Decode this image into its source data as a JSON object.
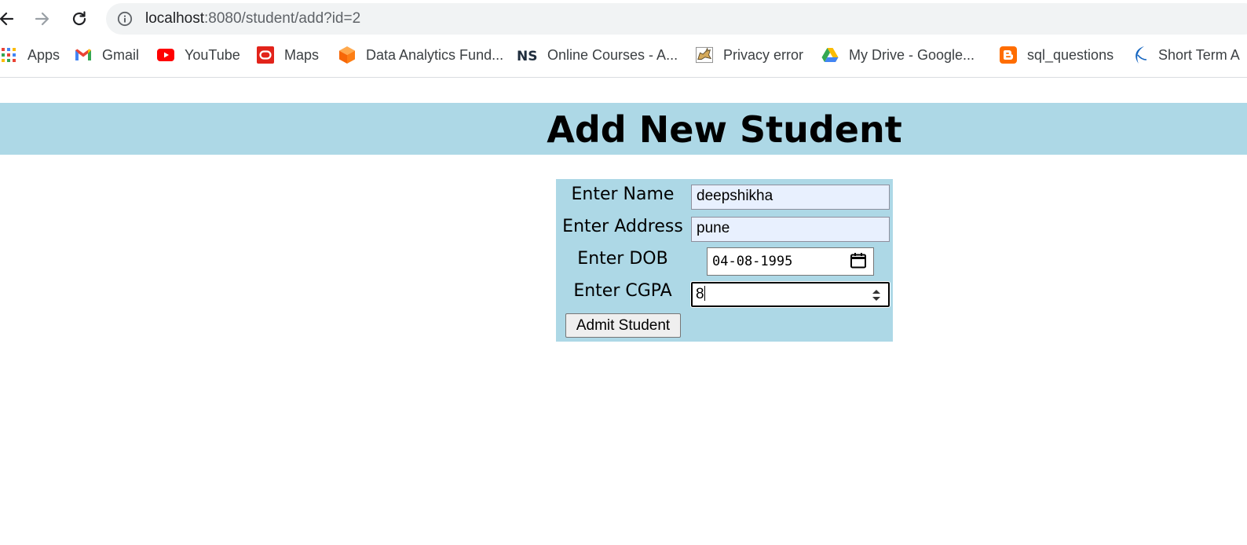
{
  "browser": {
    "url_host": "localhost",
    "url_rest": ":8080/student/add?id=2"
  },
  "bookmarks": [
    {
      "label": "Apps",
      "icon": "apps-grid-icon"
    },
    {
      "label": "Gmail",
      "icon": "gmail-icon"
    },
    {
      "label": "YouTube",
      "icon": "youtube-icon"
    },
    {
      "label": "Maps",
      "icon": "oracle-icon"
    },
    {
      "label": "Data Analytics Fund...",
      "icon": "cube-icon"
    },
    {
      "label": "Online Courses - A...",
      "icon": "ns-logo-icon"
    },
    {
      "label": "Privacy error",
      "icon": "tomcat-icon"
    },
    {
      "label": "My Drive - Google...",
      "icon": "google-drive-icon"
    },
    {
      "label": "sql_questions",
      "icon": "blogger-icon"
    },
    {
      "label": "Short Term A",
      "icon": "swoosh-logo-icon"
    }
  ],
  "page": {
    "title": "Add New Student"
  },
  "form": {
    "name_label": "Enter Name",
    "name_value": "deepshikha",
    "address_label": "Enter Address",
    "address_value": "pune",
    "dob_label": "Enter DOB",
    "dob_value": "04-08-1995",
    "cgpa_label": "Enter CGPA",
    "cgpa_value": "8",
    "submit_label": "Admit Student"
  },
  "colors": {
    "header_band": "#add8e6",
    "form_background": "#add8e6",
    "autofill_field": "#e8f0fe"
  }
}
